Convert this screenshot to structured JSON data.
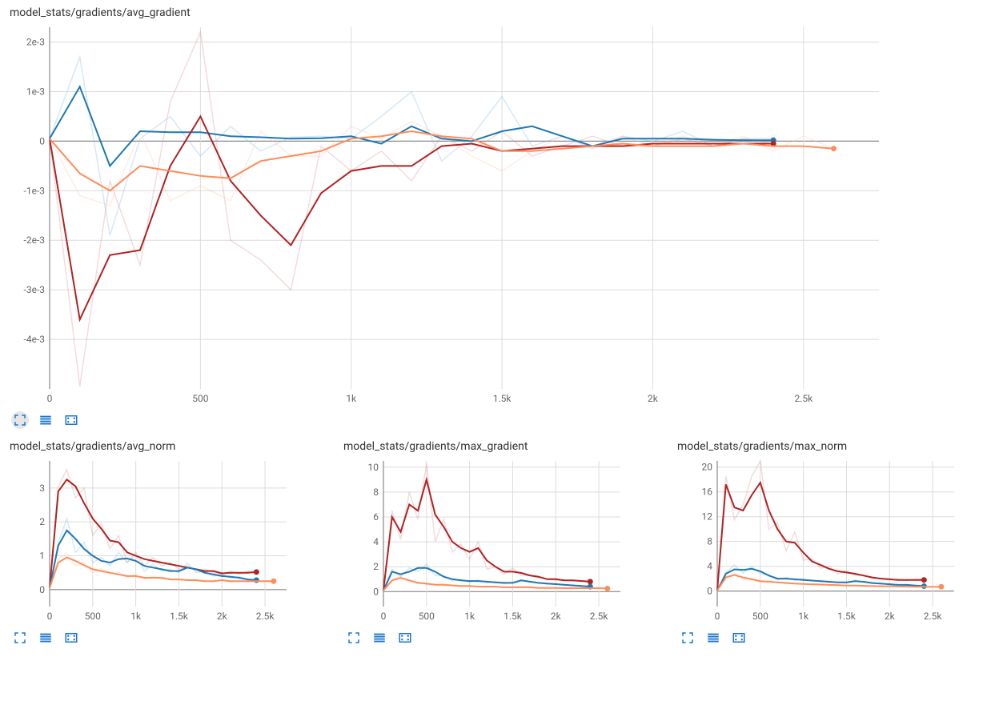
{
  "colors": {
    "blue": "#1f78b4",
    "red": "#b22222",
    "orange": "#ff8c5a",
    "blue_faint": "#7db9e0",
    "red_faint": "#d98e8e",
    "orange_faint": "#ffc4ad"
  },
  "chart_data": [
    {
      "title": "model_stats/gradients/avg_gradient",
      "type": "line",
      "xlabel": "",
      "ylabel": "",
      "ylim": [
        -0.005,
        0.0023
      ],
      "xlim": [
        0,
        2750
      ],
      "xticks": [
        0,
        500,
        1000,
        1500,
        2000,
        2500
      ],
      "xtick_labels": [
        "0",
        "500",
        "1k",
        "1.5k",
        "2k",
        "2.5k"
      ],
      "yticks": [
        -0.004,
        -0.003,
        -0.002,
        -0.001,
        0,
        0.001,
        0.002
      ],
      "ytick_labels": [
        "-4e-3",
        "-3e-3",
        "-2e-3",
        "-1e-3",
        "0",
        "1e-3",
        "2e-3"
      ],
      "x": [
        0,
        100,
        200,
        300,
        400,
        500,
        600,
        700,
        800,
        900,
        1000,
        1100,
        1200,
        1300,
        1400,
        1500,
        1600,
        1700,
        1800,
        1900,
        2000,
        2100,
        2200,
        2300,
        2400,
        2500,
        2600
      ],
      "series": [
        {
          "name": "blue",
          "color": "blue",
          "endpoint": true,
          "values": [
            5e-05,
            0.0011,
            -0.0005,
            0.0002,
            0.00018,
            0.00018,
            0.0001,
            8e-05,
            5e-05,
            6e-05,
            0.0001,
            -5e-05,
            0.0003,
            5e-05,
            0.0,
            0.0002,
            0.0003,
            0.0001,
            -0.0001,
            5e-05,
            5e-05,
            5e-05,
            3e-05,
            2e-05,
            2e-05,
            null,
            null
          ]
        },
        {
          "name": "red",
          "color": "red",
          "endpoint": true,
          "values": [
            5e-05,
            -0.0036,
            -0.0023,
            -0.0022,
            -0.0005,
            0.0005,
            -0.0008,
            -0.0015,
            -0.0021,
            -0.00105,
            -0.0006,
            -0.0005,
            -0.0005,
            -0.0001,
            -5e-05,
            -0.0002,
            -0.00015,
            -0.0001,
            -0.0001,
            -0.0001,
            -5e-05,
            -5e-05,
            -5e-05,
            -5e-05,
            -5e-05,
            null,
            null
          ]
        },
        {
          "name": "orange",
          "color": "orange",
          "endpoint": true,
          "values": [
            5e-05,
            -0.00065,
            -0.001,
            -0.0005,
            -0.0006,
            -0.0007,
            -0.00075,
            -0.0004,
            -0.0003,
            -0.0002,
            5e-05,
            0.0001,
            0.0002,
            0.0001,
            5e-05,
            -0.0002,
            -0.0002,
            -0.00015,
            -0.0001,
            -5e-05,
            -0.0001,
            -0.0001,
            -0.0001,
            -5e-05,
            -0.0001,
            -0.0001,
            -0.00015
          ]
        },
        {
          "name": "blue_faint",
          "color": "blue_faint",
          "faint": true,
          "values": [
            5e-05,
            0.0017,
            -0.0019,
            5e-05,
            0.0005,
            -0.0003,
            0.0003,
            -0.0002,
            8e-05,
            0.0001,
            5e-05,
            0.0005,
            0.001,
            -0.0004,
            0.0001,
            0.0009,
            -0.0001,
            0.0001,
            -0.00015,
            0.0001,
            0.0,
            0.0002,
            -0.0001,
            5e-05,
            5e-05,
            null,
            null
          ]
        },
        {
          "name": "red_faint",
          "color": "red_faint",
          "faint": true,
          "values": [
            5e-05,
            -0.00495,
            -0.0008,
            -0.0025,
            0.0008,
            0.0022,
            -0.002,
            -0.0024,
            -0.003,
            -0.0001,
            -0.0006,
            -0.0002,
            -0.0008,
            0.0001,
            -0.0002,
            0.0002,
            -0.0003,
            -0.0001,
            0.0001,
            -0.0001,
            -0.0001,
            5e-05,
            -0.0001,
            5e-05,
            -5e-05,
            null,
            null
          ]
        },
        {
          "name": "orange_faint",
          "color": "orange_faint",
          "faint": true,
          "values": [
            5e-05,
            -0.0011,
            -0.0013,
            0.0002,
            -0.0012,
            -0.0009,
            -0.0012,
            0.0002,
            -0.0003,
            -0.0003,
            0.0003,
            5e-05,
            0.0004,
            0.0001,
            -0.0003,
            -0.0006,
            -0.0002,
            0.0001,
            -0.0001,
            0.0001,
            -0.0001,
            0.0001,
            -0.0001,
            0.0001,
            -0.0002,
            0.0001,
            -0.00015
          ]
        }
      ]
    },
    {
      "title": "model_stats/gradients/avg_norm",
      "type": "line",
      "xlabel": "",
      "ylabel": "",
      "ylim": [
        -0.5,
        3.8
      ],
      "xlim": [
        0,
        2750
      ],
      "xticks": [
        0,
        500,
        1000,
        1500,
        2000,
        2500
      ],
      "xtick_labels": [
        "0",
        "500",
        "1k",
        "1.5k",
        "2k",
        "2.5k"
      ],
      "yticks": [
        0,
        1,
        2,
        3
      ],
      "ytick_labels": [
        "0",
        "1",
        "2",
        "3"
      ],
      "x": [
        0,
        100,
        200,
        300,
        400,
        500,
        600,
        700,
        800,
        900,
        1000,
        1100,
        1200,
        1300,
        1400,
        1500,
        1600,
        1700,
        1800,
        1900,
        2000,
        2100,
        2200,
        2300,
        2400,
        2500,
        2600
      ],
      "series": [
        {
          "name": "red",
          "color": "red",
          "endpoint": true,
          "values": [
            0.05,
            2.9,
            3.25,
            3.05,
            2.55,
            2.1,
            1.8,
            1.45,
            1.4,
            1.1,
            1.0,
            0.9,
            0.85,
            0.8,
            0.75,
            0.7,
            0.65,
            0.6,
            0.55,
            0.55,
            0.48,
            0.5,
            0.5,
            0.5,
            0.52,
            null,
            null
          ]
        },
        {
          "name": "blue",
          "color": "blue",
          "endpoint": true,
          "values": [
            0.05,
            1.3,
            1.75,
            1.5,
            1.2,
            1.0,
            0.85,
            0.8,
            0.9,
            0.92,
            0.85,
            0.7,
            0.65,
            0.6,
            0.55,
            0.55,
            0.65,
            0.6,
            0.5,
            0.45,
            0.4,
            0.38,
            0.35,
            0.3,
            0.28,
            null,
            null
          ]
        },
        {
          "name": "orange",
          "color": "orange",
          "endpoint": true,
          "values": [
            0.05,
            0.8,
            0.95,
            0.85,
            0.72,
            0.6,
            0.55,
            0.5,
            0.45,
            0.4,
            0.4,
            0.35,
            0.35,
            0.35,
            0.3,
            0.3,
            0.28,
            0.28,
            0.25,
            0.25,
            0.28,
            0.25,
            0.25,
            0.25,
            0.25,
            0.25,
            0.25
          ]
        },
        {
          "name": "red_faint",
          "color": "red_faint",
          "faint": true,
          "values": [
            0.05,
            3.05,
            3.55,
            2.7,
            3.0,
            1.6,
            1.95,
            1.2,
            1.6,
            0.8,
            1.1,
            0.7,
            0.95,
            0.7,
            0.8,
            0.6,
            0.7,
            0.55,
            0.6,
            0.5,
            0.45,
            0.55,
            0.45,
            0.55,
            0.5,
            null,
            null
          ]
        },
        {
          "name": "blue_faint",
          "color": "blue_faint",
          "faint": true,
          "values": [
            0.05,
            1.4,
            2.1,
            1.1,
            1.4,
            0.8,
            0.95,
            0.7,
            1.1,
            0.8,
            1.0,
            0.55,
            0.75,
            0.55,
            0.6,
            0.5,
            0.78,
            0.5,
            0.55,
            0.4,
            0.45,
            0.35,
            0.38,
            0.3,
            0.3,
            null,
            null
          ]
        },
        {
          "name": "orange_faint",
          "color": "orange_faint",
          "faint": true,
          "values": [
            0.05,
            0.9,
            1.08,
            0.7,
            0.8,
            0.5,
            0.62,
            0.45,
            0.5,
            0.35,
            0.45,
            0.3,
            0.4,
            0.32,
            0.32,
            0.28,
            0.3,
            0.25,
            0.28,
            0.22,
            0.3,
            0.22,
            0.28,
            0.22,
            0.28,
            0.22,
            0.28
          ]
        }
      ]
    },
    {
      "title": "model_stats/gradients/max_gradient",
      "type": "line",
      "xlabel": "",
      "ylabel": "",
      "ylim": [
        -1.2,
        10.5
      ],
      "xlim": [
        0,
        2750
      ],
      "xticks": [
        0,
        500,
        1000,
        1500,
        2000,
        2500
      ],
      "xtick_labels": [
        "0",
        "500",
        "1k",
        "1.5k",
        "2k",
        "2.5k"
      ],
      "yticks": [
        0,
        2,
        4,
        6,
        8,
        10
      ],
      "ytick_labels": [
        "0",
        "2",
        "4",
        "6",
        "8",
        "10"
      ],
      "x": [
        0,
        100,
        200,
        300,
        400,
        500,
        600,
        700,
        800,
        900,
        1000,
        1100,
        1200,
        1300,
        1400,
        1500,
        1600,
        1700,
        1800,
        1900,
        2000,
        2100,
        2200,
        2300,
        2400,
        2500,
        2600
      ],
      "series": [
        {
          "name": "red",
          "color": "red",
          "endpoint": true,
          "values": [
            0.1,
            6.0,
            4.8,
            7.0,
            6.5,
            9.0,
            6.2,
            5.2,
            4.0,
            3.5,
            3.2,
            3.5,
            2.5,
            2.0,
            1.6,
            1.6,
            1.5,
            1.3,
            1.2,
            1.0,
            1.0,
            0.9,
            0.9,
            0.85,
            0.8,
            null,
            null
          ]
        },
        {
          "name": "blue",
          "color": "blue",
          "endpoint": true,
          "values": [
            0.1,
            1.6,
            1.4,
            1.6,
            1.9,
            1.9,
            1.6,
            1.2,
            1.0,
            0.9,
            0.85,
            0.85,
            0.8,
            0.75,
            0.7,
            0.7,
            0.9,
            0.8,
            0.7,
            0.65,
            0.6,
            0.55,
            0.5,
            0.45,
            0.4,
            null,
            null
          ]
        },
        {
          "name": "orange",
          "color": "orange",
          "endpoint": true,
          "values": [
            0.1,
            0.9,
            1.1,
            0.9,
            0.7,
            0.65,
            0.55,
            0.55,
            0.5,
            0.45,
            0.45,
            0.4,
            0.4,
            0.4,
            0.35,
            0.35,
            0.35,
            0.35,
            0.3,
            0.3,
            0.3,
            0.28,
            0.28,
            0.28,
            0.28,
            0.28,
            0.25
          ]
        },
        {
          "name": "red_faint",
          "color": "red_faint",
          "faint": true,
          "values": [
            0.1,
            6.5,
            4.2,
            8.0,
            5.8,
            10.3,
            4.0,
            5.8,
            3.2,
            3.8,
            2.6,
            4.0,
            1.8,
            2.0,
            1.4,
            1.9,
            1.3,
            1.3,
            1.1,
            1.0,
            0.9,
            0.9,
            0.85,
            0.9,
            0.8,
            null,
            null
          ]
        },
        {
          "name": "blue_faint",
          "color": "blue_faint",
          "faint": true,
          "values": [
            0.1,
            1.8,
            1.2,
            1.9,
            1.6,
            2.2,
            1.3,
            1.3,
            0.85,
            1.0,
            0.75,
            0.95,
            0.7,
            0.8,
            0.62,
            0.78,
            0.95,
            0.75,
            0.7,
            0.6,
            0.65,
            0.5,
            0.55,
            0.4,
            0.42,
            null,
            null
          ]
        },
        {
          "name": "orange_faint",
          "color": "orange_faint",
          "faint": true,
          "values": [
            0.1,
            1.0,
            1.25,
            0.7,
            0.8,
            0.55,
            0.6,
            0.5,
            0.55,
            0.4,
            0.5,
            0.35,
            0.45,
            0.38,
            0.35,
            0.32,
            0.4,
            0.3,
            0.32,
            0.28,
            0.32,
            0.25,
            0.3,
            0.25,
            0.3,
            0.25,
            0.28
          ]
        }
      ]
    },
    {
      "title": "model_stats/gradients/max_norm",
      "type": "line",
      "xlabel": "",
      "ylabel": "",
      "ylim": [
        -2.5,
        21
      ],
      "xlim": [
        0,
        2750
      ],
      "xticks": [
        0,
        500,
        1000,
        1500,
        2000,
        2500
      ],
      "xtick_labels": [
        "0",
        "500",
        "1k",
        "1.5k",
        "2k",
        "2.5k"
      ],
      "yticks": [
        0,
        4,
        8,
        12,
        16,
        20
      ],
      "ytick_labels": [
        "0",
        "4",
        "8",
        "12",
        "16",
        "20"
      ],
      "x": [
        0,
        100,
        200,
        300,
        400,
        500,
        600,
        700,
        800,
        900,
        1000,
        1100,
        1200,
        1300,
        1400,
        1500,
        1600,
        1700,
        1800,
        1900,
        2000,
        2100,
        2200,
        2300,
        2400,
        2500,
        2600
      ],
      "series": [
        {
          "name": "red",
          "color": "red",
          "endpoint": true,
          "values": [
            0.1,
            17.2,
            13.5,
            13.0,
            15.5,
            17.5,
            13.0,
            10.0,
            8.0,
            7.8,
            6.2,
            4.8,
            4.2,
            3.6,
            3.2,
            3.0,
            2.8,
            2.5,
            2.2,
            2.0,
            1.9,
            1.8,
            1.8,
            1.8,
            1.8,
            null,
            null
          ]
        },
        {
          "name": "blue",
          "color": "blue",
          "endpoint": true,
          "values": [
            0.1,
            2.8,
            3.5,
            3.4,
            3.6,
            3.2,
            2.5,
            2.0,
            2.0,
            1.9,
            1.8,
            1.7,
            1.6,
            1.5,
            1.4,
            1.4,
            1.6,
            1.5,
            1.3,
            1.2,
            1.1,
            1.0,
            1.0,
            0.9,
            0.8,
            null,
            null
          ]
        },
        {
          "name": "orange",
          "color": "orange",
          "endpoint": true,
          "values": [
            0.1,
            2.2,
            2.6,
            2.2,
            1.9,
            1.6,
            1.5,
            1.4,
            1.3,
            1.2,
            1.15,
            1.1,
            1.05,
            1.0,
            0.95,
            0.9,
            0.9,
            0.85,
            0.8,
            0.78,
            0.78,
            0.75,
            0.72,
            0.7,
            0.7,
            0.7,
            0.7
          ]
        },
        {
          "name": "red_faint",
          "color": "red_faint",
          "faint": true,
          "values": [
            0.1,
            18.5,
            11.5,
            14.0,
            18.5,
            21.0,
            10.0,
            11.0,
            6.5,
            9.5,
            5.0,
            5.2,
            3.7,
            4.0,
            2.8,
            3.3,
            2.5,
            2.6,
            2.0,
            2.1,
            1.8,
            1.9,
            1.7,
            1.9,
            1.8,
            null,
            null
          ]
        },
        {
          "name": "blue_faint",
          "color": "blue_faint",
          "faint": true,
          "values": [
            0.1,
            3.0,
            4.2,
            2.9,
            4.0,
            2.8,
            2.6,
            1.8,
            2.2,
            1.7,
            2.0,
            1.6,
            1.7,
            1.4,
            1.5,
            1.3,
            1.8,
            1.4,
            1.4,
            1.1,
            1.2,
            0.95,
            1.05,
            0.85,
            0.85,
            null,
            null
          ]
        },
        {
          "name": "orange_faint",
          "color": "orange_faint",
          "faint": true,
          "values": [
            0.1,
            2.4,
            2.9,
            1.9,
            2.1,
            1.4,
            1.7,
            1.3,
            1.45,
            1.1,
            1.25,
            1.0,
            1.15,
            0.95,
            1.0,
            0.85,
            0.95,
            0.8,
            0.85,
            0.75,
            0.82,
            0.7,
            0.78,
            0.65,
            0.75,
            0.65,
            0.72
          ]
        }
      ]
    }
  ],
  "toolbar": {
    "fullscreen_tip": "Fullscreen",
    "toggle_y_tip": "Toggle y-axis log scale",
    "fit_tip": "Fit domain"
  }
}
